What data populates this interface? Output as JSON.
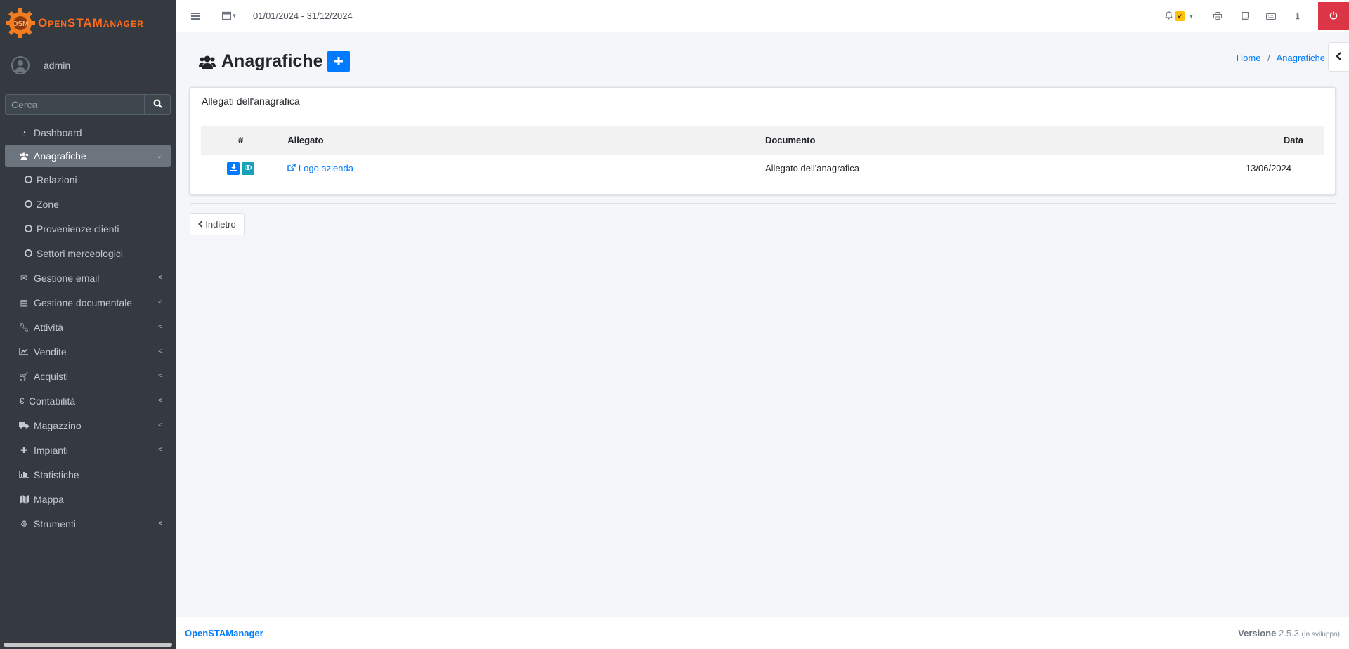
{
  "brand": {
    "name": "OpenSTAManager",
    "logo_text": "OSM"
  },
  "user": {
    "name": "admin"
  },
  "search": {
    "placeholder": "Cerca"
  },
  "sidebar": {
    "items": [
      {
        "label": "Dashboard",
        "icon": "dashboard-icon"
      },
      {
        "label": "Anagrafiche",
        "icon": "users-icon"
      },
      {
        "label": "Relazioni",
        "icon": "circle-icon"
      },
      {
        "label": "Zone",
        "icon": "circle-icon"
      },
      {
        "label": "Provenienze clienti",
        "icon": "circle-icon"
      },
      {
        "label": "Settori merceologici",
        "icon": "circle-icon"
      },
      {
        "label": "Gestione email",
        "icon": "envelope-icon"
      },
      {
        "label": "Gestione documentale",
        "icon": "file-icon"
      },
      {
        "label": "Attività",
        "icon": "wrench-icon"
      },
      {
        "label": "Vendite",
        "icon": "line-chart-icon"
      },
      {
        "label": "Acquisti",
        "icon": "cart-icon"
      },
      {
        "label": "Contabilità",
        "icon": "euro-icon"
      },
      {
        "label": "Magazzino",
        "icon": "truck-icon"
      },
      {
        "label": "Impianti",
        "icon": "puzzle-icon"
      },
      {
        "label": "Statistiche",
        "icon": "bar-chart-icon"
      },
      {
        "label": "Mappa",
        "icon": "map-icon"
      },
      {
        "label": "Strumenti",
        "icon": "gear-icon"
      }
    ]
  },
  "topbar": {
    "period": "01/01/2024 - 31/12/2024"
  },
  "page": {
    "title": "Anagrafiche",
    "breadcrumb": {
      "home": "Home",
      "current": "Anagrafiche",
      "separator": "/"
    }
  },
  "card": {
    "title": "Allegati dell'anagrafica",
    "columns": [
      "#",
      "Allegato",
      "Documento",
      "Data"
    ],
    "rows": [
      {
        "allegato": "Logo azienda",
        "documento": "Allegato dell'anagrafica",
        "data": "13/06/2024"
      }
    ]
  },
  "back_button": {
    "label": "Indietro"
  },
  "footer": {
    "brand": "OpenSTAManager",
    "version_label": "Versione",
    "version": "2.5.3",
    "version_note": "(In sviluppo)"
  },
  "colors": {
    "primary": "#007bff",
    "info": "#17a2b8",
    "danger": "#dc3545",
    "warning": "#ffc107",
    "sidebar": "#343a40",
    "brand_orange": "#ff6b1a"
  }
}
